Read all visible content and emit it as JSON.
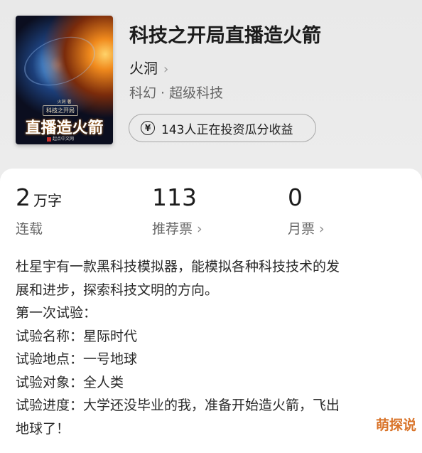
{
  "book": {
    "title": "科技之开局直播造火箭",
    "author": "火洞",
    "author_chevron": "›",
    "genre": "科幻 · 超级科技",
    "invest_icon": "¥",
    "invest_text": "143人正在投资瓜分收益",
    "cover": {
      "author_line": "火洞 著",
      "subtitle": "科技之开局",
      "title": "直播造火箭",
      "publisher": "起点中文网"
    }
  },
  "stats": {
    "words": {
      "value": "2",
      "unit": "万字",
      "label": "连载"
    },
    "recommend": {
      "value": "113",
      "label": "推荐票",
      "chevron": "›"
    },
    "monthly": {
      "value": "0",
      "label": "月票",
      "chevron": "›"
    }
  },
  "description": {
    "lines": [
      "杜星宇有一款黑科技模拟器，能模拟各种科技技术的发",
      "展和进步，探索科技文明的方向。",
      "第一次试验：",
      "试验名称：星际时代",
      "试验地点：一号地球",
      "试验对象：全人类",
      "试验进度：大学还没毕业的我，准备开始造火箭，飞出",
      "地球了！"
    ]
  },
  "watermark": "萌探说"
}
